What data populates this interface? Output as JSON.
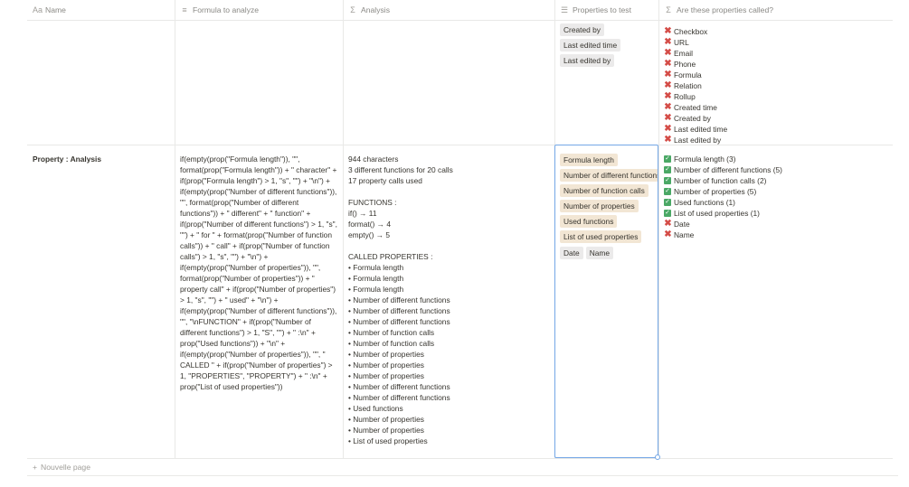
{
  "columns": [
    {
      "icon": "Aa",
      "label": "Name"
    },
    {
      "icon": "≡",
      "label": "Formula to analyze"
    },
    {
      "icon": "Σ",
      "label": "Analysis"
    },
    {
      "icon": "☰",
      "label": "Properties to test"
    },
    {
      "icon": "Σ",
      "label": "Are these properties called?"
    }
  ],
  "row1": {
    "properties_to_test": [
      "Created by",
      "Last edited time",
      "Last edited by"
    ],
    "called": [
      {
        "status": "no",
        "label": "Checkbox"
      },
      {
        "status": "no",
        "label": "URL"
      },
      {
        "status": "no",
        "label": "Email"
      },
      {
        "status": "no",
        "label": "Phone"
      },
      {
        "status": "no",
        "label": "Formula"
      },
      {
        "status": "no",
        "label": "Relation"
      },
      {
        "status": "no",
        "label": "Rollup"
      },
      {
        "status": "no",
        "label": "Created time"
      },
      {
        "status": "no",
        "label": "Created by"
      },
      {
        "status": "no",
        "label": "Last edited time"
      },
      {
        "status": "no",
        "label": "Last edited by"
      }
    ]
  },
  "row2": {
    "name": "Property : Analysis",
    "formula": "if(empty(prop(\"Formula length\")), \"\", format(prop(\"Formula length\")) + \" character\" + if(prop(\"Formula length\") > 1, \"s\", \"\") + \"\\n\") + if(empty(prop(\"Number of different functions\")), \"\", format(prop(\"Number of different functions\")) + \" different\" + \" function\" + if(prop(\"Number of different functions\") > 1, \"s\", \"\") + \" for \" + format(prop(\"Number of function calls\")) + \" call\" + if(prop(\"Number of function calls\") > 1, \"s\", \"\") + \"\\n\") + if(empty(prop(\"Number of properties\")), \"\", format(prop(\"Number of properties\")) + \" property call\" + if(prop(\"Number of properties\") > 1, \"s\", \"\") + \" used\" + \"\\n\") + if(empty(prop(\"Number of different functions\")), \"\", \"\\nFUNCTION\" + if(prop(\"Number of different functions\") > 1, \"S\", \"\") + \" :\\n\" + prop(\"Used functions\")) + \"\\n\" + if(empty(prop(\"Number of properties\")), \"\", \" CALLED \" + if(prop(\"Number of properties\") > 1, \"PROPERTIES\", \"PROPERTY\") + \" :\\n\" + prop(\"List of used properties\"))",
    "analysis_lines": [
      "944 characters",
      "3 different functions for 20 calls",
      "17 property calls used",
      "",
      "FUNCTIONS :",
      "if()            →     11",
      "format()     →     4",
      "empty()      →     5",
      "",
      "CALLED PROPERTIES :",
      "• Formula length",
      "• Formula length",
      "• Formula length",
      "• Number of different functions",
      "• Number of different functions",
      "• Number of different functions",
      "• Number of function calls",
      "• Number of function calls",
      "• Number of properties",
      "• Number of properties",
      "• Number of properties",
      "• Number of different functions",
      "• Number of different functions",
      "• Used functions",
      "• Number of properties",
      "• Number of properties",
      "• List of used properties"
    ],
    "properties_to_test": [
      {
        "label": "Formula length",
        "color": "#f2e6d4"
      },
      {
        "label": "Number of different functions",
        "color": "#f2e6d4"
      },
      {
        "label": "Number of function calls",
        "color": "#f2e6d4"
      },
      {
        "label": "Number of properties",
        "color": "#f2e6d4"
      },
      {
        "label": "Used functions",
        "color": "#f2e6d4"
      },
      {
        "label": "List of used properties",
        "color": "#f2e6d4"
      },
      {
        "label": "Date",
        "color": "#ebeaea"
      },
      {
        "label": "Name",
        "color": "#ebeaea"
      }
    ],
    "called": [
      {
        "status": "yes",
        "label": "Formula length (3)"
      },
      {
        "status": "yes",
        "label": "Number of different functions (5)"
      },
      {
        "status": "yes",
        "label": "Number of function calls (2)"
      },
      {
        "status": "yes",
        "label": "Number of properties (5)"
      },
      {
        "status": "yes",
        "label": "Used functions (1)"
      },
      {
        "status": "yes",
        "label": "List of used properties (1)"
      },
      {
        "status": "no",
        "label": "Date"
      },
      {
        "status": "no",
        "label": "Name"
      }
    ]
  },
  "new_page": {
    "icon": "+",
    "label": "Nouvelle page"
  },
  "colors": {
    "selection": "#74a7e6",
    "check_green": "#4aa865",
    "cross_red": "#d44c47",
    "tag_beige": "#f2e6d4",
    "tag_gray": "#ebeaea"
  }
}
